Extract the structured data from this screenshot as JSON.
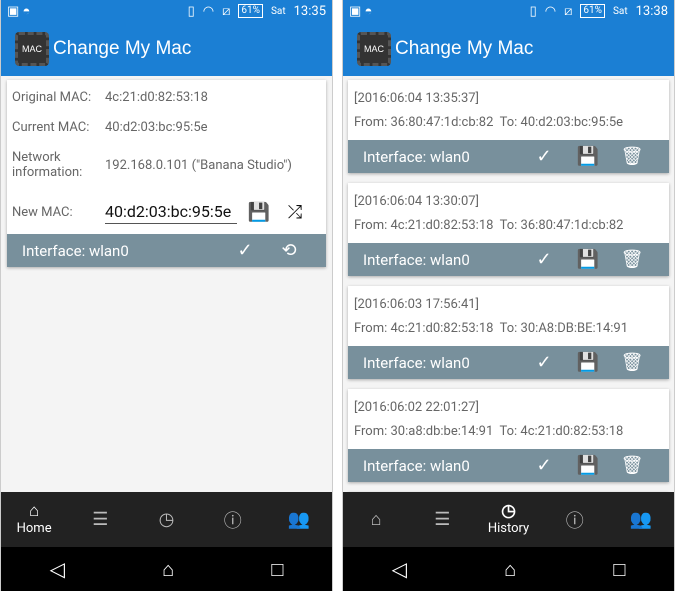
{
  "status_left": {
    "day": "Sat",
    "time": "13:35",
    "battery": "61%"
  },
  "status_right": {
    "day": "Sat",
    "time": "13:38",
    "battery": "61%"
  },
  "app": {
    "title": "Change My Mac",
    "logo_text": "MAC"
  },
  "home": {
    "original_label": "Original MAC:",
    "original_value": "4c:21:d0:82:53:18",
    "current_label": "Current MAC:",
    "current_value": "40:d2:03:bc:95:5e",
    "network_label": "Network information:",
    "network_value": "192.168.0.101 (\"Banana Studio\")",
    "new_label": "New MAC:",
    "new_value": "40:d2:03:bc:95:5e",
    "interface": "Interface: wlan0"
  },
  "history": [
    {
      "date": "[2016:06:04 13:35:37]",
      "from": "From: 36:80:47:1d:cb:82",
      "to": "To: 40:d2:03:bc:95:5e",
      "interface": "Interface: wlan0"
    },
    {
      "date": "[2016:06:04 13:30:07]",
      "from": "From: 4c:21:d0:82:53:18",
      "to": "To: 36:80:47:1d:cb:82",
      "interface": "Interface: wlan0"
    },
    {
      "date": "[2016:06:03 17:56:41]",
      "from": "From: 4c:21:d0:82:53:18",
      "to": "To: 30:A8:DB:BE:14:91",
      "interface": "Interface: wlan0"
    },
    {
      "date": "[2016:06:02 22:01:27]",
      "from": "From: 30:a8:db:be:14:91",
      "to": "To: 4c:21:d0:82:53:18",
      "interface": "Interface: wlan0"
    }
  ],
  "nav": {
    "home": "Home",
    "history": "History"
  },
  "colors": {
    "primary": "#1b7fd4",
    "bar": "#78909c",
    "bottom_nav": "#222222"
  }
}
